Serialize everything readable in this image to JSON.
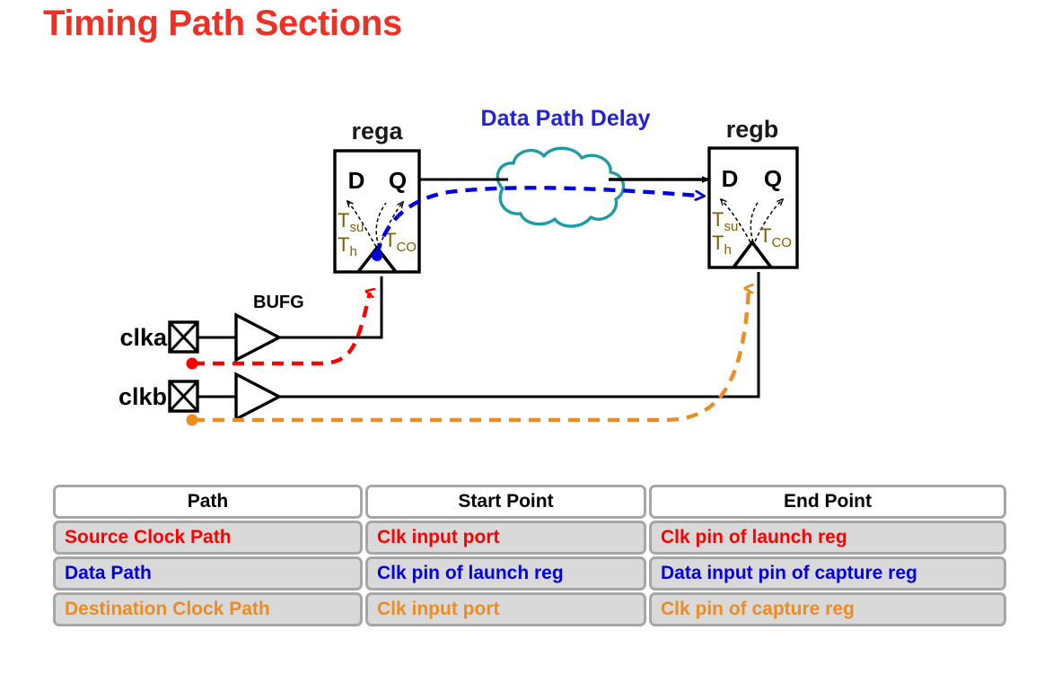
{
  "page": {
    "title": "Timing Path Sections",
    "title_color": "#EE3124"
  },
  "diagram": {
    "labels": {
      "rega": "rega",
      "regb": "regb",
      "data_path_delay": "Data Path Delay",
      "bufg": "BUFG",
      "clka": "clka",
      "clkb": "clkb"
    },
    "rega_pins": {
      "d": "D",
      "q": "Q",
      "t_su": "T",
      "t_su_sub": "su",
      "t_h": "T",
      "t_h_sub": "h",
      "t_co": "T",
      "t_co_sub": "CO"
    },
    "regb_pins": {
      "d": "D",
      "q": "Q",
      "t_su": "T",
      "t_su_sub": "su",
      "t_h": "T",
      "t_h_sub": "h",
      "t_co": "T",
      "t_co_sub": "CO"
    },
    "colors": {
      "source_clock_path": "#FF0000",
      "data_path": "#0000E0",
      "destination_clock_path": "#ED8C20",
      "cloud": "#1F9BA5",
      "timing_param": "#7F6000",
      "wire": "#000000",
      "data_path_delay_label": "#2222DD"
    }
  },
  "table": {
    "headers": [
      "Path",
      "Start Point",
      "End Point"
    ],
    "rows": [
      {
        "path": "Source Clock Path",
        "start": "Clk input port",
        "end": "Clk pin of launch reg",
        "color": "#FF0000"
      },
      {
        "path": "Data Path",
        "start": "Clk pin of launch reg",
        "end": "Data input pin of capture reg",
        "color": "#0000E0"
      },
      {
        "path": "Destination Clock Path",
        "start": "Clk input port",
        "end": "Clk pin of capture reg",
        "color": "#ED8C20"
      }
    ]
  }
}
